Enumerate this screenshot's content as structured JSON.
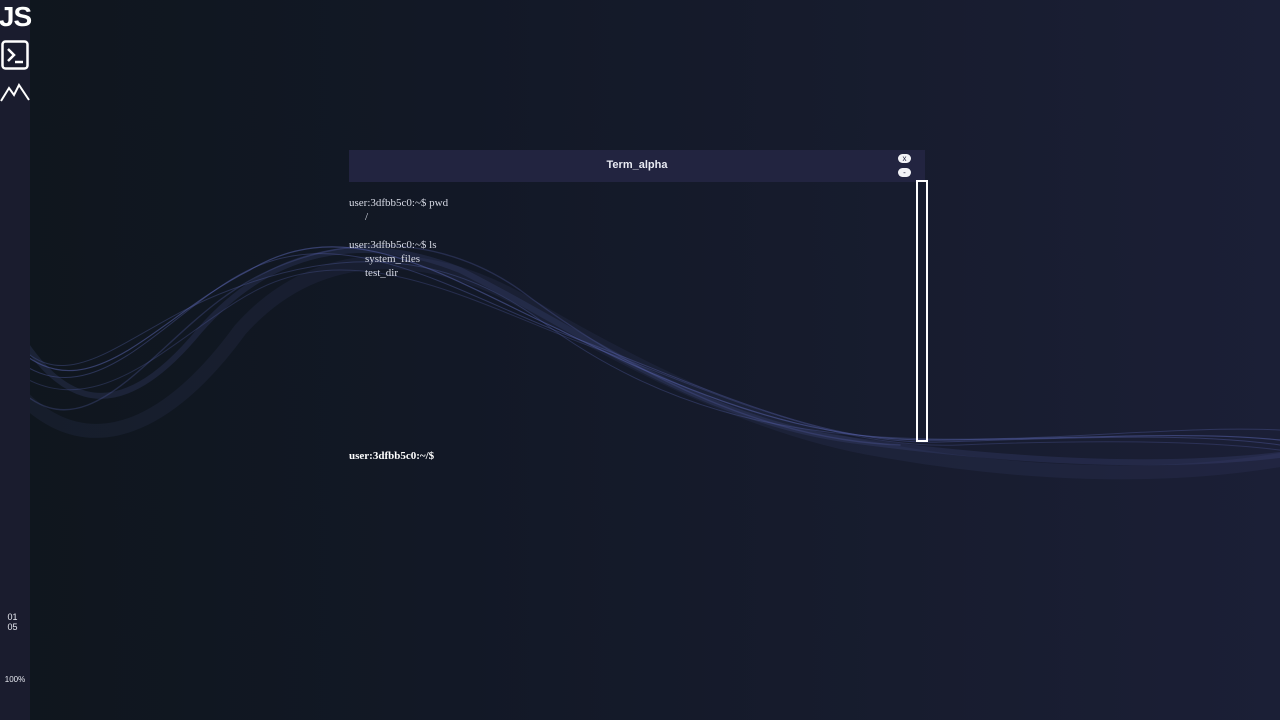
{
  "dock": {
    "js_label": "JS",
    "date_line1": "01",
    "date_line2": "05",
    "zoom": "100%"
  },
  "terminal": {
    "title": "Term_alpha",
    "close_label": "x",
    "minimize_label": "-",
    "history": [
      {
        "command": "user:3dfbb5c0:~$ pwd",
        "output": [
          "/"
        ]
      },
      {
        "command": "user:3dfbb5c0:~$ ls",
        "output": [
          "system_files",
          "test_dir"
        ]
      }
    ],
    "prompt": "user:3dfbb5c0:~/$",
    "input_value": ""
  },
  "colors": {
    "dock_bg": "#1a1c2e",
    "titlebar_bg": "#222440",
    "wave": "#5560a8"
  }
}
